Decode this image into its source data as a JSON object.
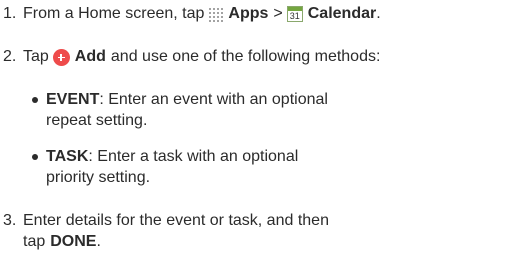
{
  "steps": [
    {
      "number": "1.",
      "pre": "From a Home screen, tap",
      "apps": "Apps",
      "sep": ">",
      "calendar_icon_day": "31",
      "calendar": "Calendar",
      "end": "."
    },
    {
      "number": "2.",
      "pre": "Tap",
      "add": "Add",
      "post": "and use one of the following methods:"
    },
    {
      "number": "3.",
      "line1": "Enter details for the event or task, and then",
      "pre2": "tap",
      "done": "DONE",
      "end": "."
    }
  ],
  "methods": [
    {
      "term": "EVENT",
      "line1": ": Enter an event with an optional",
      "line2": "repeat setting."
    },
    {
      "term": "TASK",
      "line1": ": Enter a task with an optional",
      "line2": "priority setting."
    }
  ],
  "icons": {
    "apps": "apps-grid-icon",
    "calendar": "calendar-icon",
    "add": "add-icon"
  },
  "colors": {
    "text": "#2b2b2b",
    "add_icon": "#ee4b4b",
    "calendar_icon": "#74a63f"
  }
}
